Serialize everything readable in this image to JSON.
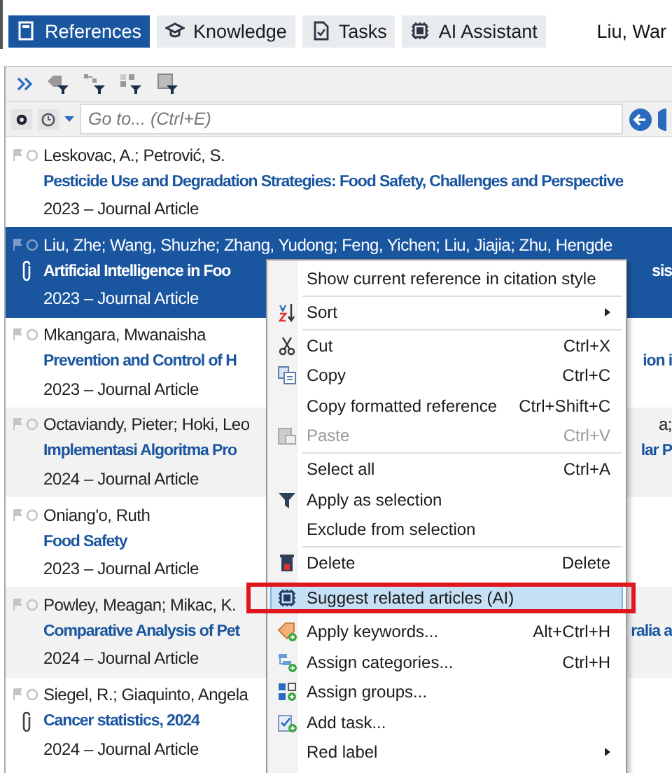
{
  "tabs": [
    {
      "label": "References",
      "selected": true,
      "kind": "book"
    },
    {
      "label": "Knowledge",
      "selected": false,
      "kind": "cap"
    },
    {
      "label": "Tasks",
      "selected": false,
      "kind": "task"
    },
    {
      "label": "AI Assistant",
      "selected": false,
      "kind": "ai"
    }
  ],
  "user": "Liu, War",
  "goto": {
    "placeholder": "Go to... (Ctrl+E)"
  },
  "references": [
    {
      "authors": "Leskovac, A.; Petrović, S.",
      "title": "Pesticide Use and Degradation Strategies: Food Safety, Challenges and Perspective",
      "meta": "2023 – Journal Article",
      "attachment": false,
      "selected": false
    },
    {
      "authors": "Liu, Zhe; Wang, Shuzhe; Zhang, Yudong; Feng, Yichen; Liu, Jiajia; Zhu, Hengde",
      "title": "Artificial Intelligence in Foo",
      "title_tail": "sis",
      "meta": "2023 – Journal Article",
      "attachment": true,
      "selected": true
    },
    {
      "authors": "Mkangara, Mwanaisha",
      "title": "Prevention and Control of H",
      "title_tail": "ion i",
      "meta": "2023 – Journal Article",
      "attachment": false,
      "selected": false
    },
    {
      "authors": "Octaviandy, Pieter; Hoki, Leo",
      "authors_tail": "a;",
      "title": "Implementasi Algoritma Pro",
      "title_tail": "lar P",
      "meta": "2024 – Journal Article",
      "attachment": false,
      "selected": false
    },
    {
      "authors": "Oniang'o, Ruth",
      "title": "Food Safety",
      "meta": "2023 – Journal Article",
      "attachment": false,
      "selected": false
    },
    {
      "authors": "Powley, Meagan; Mikac, K.",
      "title": "Comparative Analysis of Pet",
      "title_tail": "ralia a",
      "meta": "2024 – Journal Article",
      "attachment": false,
      "selected": false
    },
    {
      "authors": "Siegel, R.; Giaquinto, Angela",
      "title": "Cancer statistics, 2024",
      "meta": "2024 – Journal Article",
      "attachment": true,
      "selected": false
    }
  ],
  "context_menu": {
    "items": [
      {
        "label": "Show current reference in citation style",
        "divider": false,
        "disabled": false,
        "selected": false,
        "submenu": false,
        "callout": false
      },
      {
        "label": "Sort",
        "kind": "sort",
        "divider": true,
        "disabled": false,
        "selected": false,
        "submenu": true,
        "callout": false
      },
      {
        "label": "Cut",
        "shortcut": "Ctrl+X",
        "kind": "scissors",
        "divider": true,
        "disabled": false,
        "selected": false,
        "submenu": false,
        "callout": false
      },
      {
        "label": "Copy",
        "shortcut": "Ctrl+C",
        "kind": "copy",
        "divider": false,
        "disabled": false,
        "selected": false,
        "submenu": false,
        "callout": false
      },
      {
        "label": "Copy formatted reference",
        "shortcut": "Ctrl+Shift+C",
        "divider": false,
        "disabled": false,
        "selected": false,
        "submenu": false,
        "callout": false
      },
      {
        "label": "Paste",
        "shortcut": "Ctrl+V",
        "kind": "paste",
        "divider": false,
        "disabled": true,
        "selected": false,
        "submenu": false,
        "callout": false
      },
      {
        "label": "Select all",
        "shortcut": "Ctrl+A",
        "divider": true,
        "disabled": false,
        "selected": false,
        "submenu": false,
        "callout": false
      },
      {
        "label": "Apply as selection",
        "kind": "filter",
        "divider": false,
        "disabled": false,
        "selected": false,
        "submenu": false,
        "callout": false
      },
      {
        "label": "Exclude from selection",
        "divider": false,
        "disabled": false,
        "selected": false,
        "submenu": false,
        "callout": false
      },
      {
        "label": "Delete",
        "shortcut": "Delete",
        "kind": "trash",
        "divider": true,
        "disabled": false,
        "selected": false,
        "submenu": false,
        "callout": false
      },
      {
        "label": "Suggest related articles (AI)",
        "kind": "ai",
        "divider": false,
        "disabled": false,
        "selected": true,
        "submenu": false,
        "callout": true
      },
      {
        "label": "Apply keywords...",
        "shortcut": "Alt+Ctrl+H",
        "kind": "keyword",
        "divider": false,
        "disabled": false,
        "selected": false,
        "submenu": false,
        "callout": false
      },
      {
        "label": "Assign categories...",
        "shortcut": "Ctrl+H",
        "kind": "categories",
        "divider": false,
        "disabled": false,
        "selected": false,
        "submenu": false,
        "callout": false
      },
      {
        "label": "Assign groups...",
        "kind": "groups",
        "divider": false,
        "disabled": false,
        "selected": false,
        "submenu": false,
        "callout": false
      },
      {
        "label": "Add task...",
        "kind": "task",
        "divider": false,
        "disabled": false,
        "selected": false,
        "submenu": false,
        "callout": false
      },
      {
        "label": "Red label",
        "divider": false,
        "disabled": false,
        "selected": false,
        "submenu": true,
        "callout": false
      }
    ]
  }
}
